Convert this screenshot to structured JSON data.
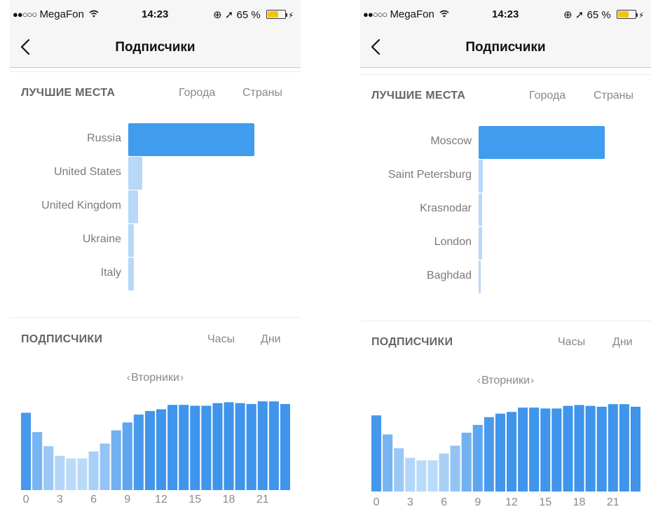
{
  "colors": {
    "accent": "#3d8fe8",
    "bar_primary": "#3f9cee",
    "bar_secondary": "#b7d8f8",
    "label_gray": "#7a7a7a"
  },
  "screens": [
    {
      "status": {
        "signal": "●●○○○",
        "carrier": "MegaFon",
        "wifi_icon": "wifi-icon",
        "time": "14:23",
        "indicators": "⊕ ➚",
        "battery": "65 %",
        "battery_level": 0.65
      },
      "nav": {
        "title": "Подписчики",
        "back_icon": "chevron-left-icon"
      },
      "top_places": {
        "title": "ЛУЧШИЕ МЕСТА",
        "tabs": [
          {
            "label": "Города",
            "active": false
          },
          {
            "label": "Страны",
            "active": true
          }
        ],
        "items": [
          {
            "label": "Russia",
            "value": 1.0
          },
          {
            "label": "United States",
            "value": 0.11
          },
          {
            "label": "United Kingdom",
            "value": 0.08
          },
          {
            "label": "Ukraine",
            "value": 0.045
          },
          {
            "label": "Italy",
            "value": 0.045
          }
        ]
      },
      "followers": {
        "title": "ПОДПИСЧИКИ",
        "tabs": [
          {
            "label": "Часы",
            "active": true
          },
          {
            "label": "Дни",
            "active": false
          }
        ],
        "day": "Вторники",
        "prev_arrow": "‹",
        "next_arrow": "›",
        "x_ticks": [
          "0",
          "3",
          "6",
          "9",
          "12",
          "15",
          "18",
          "21"
        ],
        "hourly": [
          0.88,
          0.66,
          0.5,
          0.39,
          0.36,
          0.36,
          0.44,
          0.53,
          0.68,
          0.77,
          0.86,
          0.9,
          0.92,
          0.97,
          0.97,
          0.96,
          0.96,
          0.99,
          1.0,
          0.99,
          0.98,
          1.01,
          1.01,
          0.98
        ]
      }
    },
    {
      "status": {
        "signal": "●●○○○",
        "carrier": "MegaFon",
        "wifi_icon": "wifi-icon",
        "time": "14:23",
        "indicators": "⊕ ➚",
        "battery": "65 %",
        "battery_level": 0.65
      },
      "nav": {
        "title": "Подписчики",
        "back_icon": "chevron-left-icon"
      },
      "top_places": {
        "title": "ЛУЧШИЕ МЕСТА",
        "tabs": [
          {
            "label": "Города",
            "active": true
          },
          {
            "label": "Страны",
            "active": false
          }
        ],
        "items": [
          {
            "label": "Moscow",
            "value": 1.0
          },
          {
            "label": "Saint Petersburg",
            "value": 0.035
          },
          {
            "label": "Krasnodar",
            "value": 0.025
          },
          {
            "label": "London",
            "value": 0.025
          },
          {
            "label": "Baghdad",
            "value": 0.012
          }
        ]
      },
      "followers": {
        "title": "ПОДПИСЧИКИ",
        "tabs": [
          {
            "label": "Часы",
            "active": true
          },
          {
            "label": "Дни",
            "active": false
          }
        ],
        "day": "Вторники",
        "prev_arrow": "‹",
        "next_arrow": "›",
        "x_ticks": [
          "0",
          "3",
          "6",
          "9",
          "12",
          "15",
          "18",
          "21"
        ],
        "hourly": [
          0.88,
          0.66,
          0.5,
          0.39,
          0.36,
          0.36,
          0.44,
          0.53,
          0.68,
          0.77,
          0.86,
          0.9,
          0.92,
          0.97,
          0.97,
          0.96,
          0.96,
          0.99,
          1.0,
          0.99,
          0.98,
          1.01,
          1.01,
          0.98
        ]
      }
    }
  ]
}
